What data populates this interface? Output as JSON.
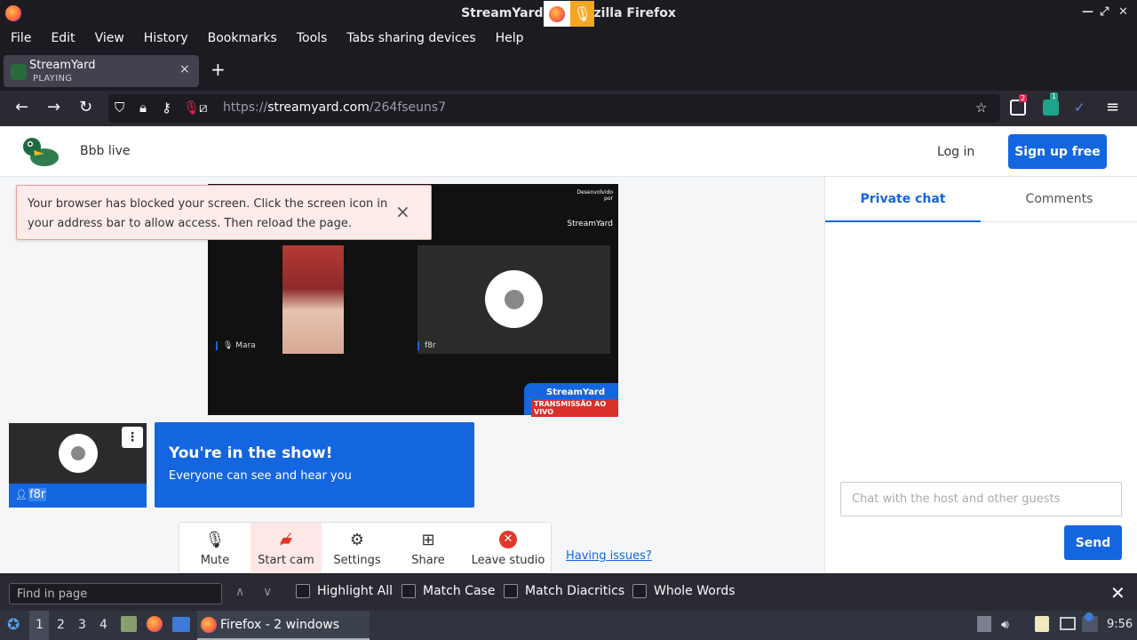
{
  "window": {
    "title": "StreamYard - Mozilla Firefox",
    "title_visible": "StreamYard",
    "title_suffix": "zilla Firefox"
  },
  "menubar": {
    "items": [
      "File",
      "Edit",
      "View",
      "History",
      "Bookmarks",
      "Tools",
      "Tabs sharing devices",
      "Help"
    ]
  },
  "tab": {
    "title": "StreamYard",
    "status": "PLAYING",
    "close": "×"
  },
  "newtab": "+",
  "urlbar": {
    "domain_prefix": "https://",
    "domain": "streamyard.com",
    "path": "/264fseuns7"
  },
  "extensions": {
    "badge1": "2",
    "badge2": "1"
  },
  "site": {
    "room_name": "Bbb live",
    "login": "Log in",
    "signup": "Sign up free"
  },
  "alert": {
    "message": "Your browser has blocked your screen. Click the screen icon in your address bar to allow access. Then reload the page.",
    "close": "×"
  },
  "stage": {
    "participant1": "Mara",
    "participant2": "f8r",
    "brand_small": "Desenvolvido por",
    "brand_name": "StreamYard",
    "banner_title": "StreamYard",
    "banner_live": "TRANSMISSÃO AO VIVO"
  },
  "self_tile": {
    "name": "f8r",
    "menu": "⋮"
  },
  "in_show": {
    "title": "You're in the show!",
    "subtitle": "Everyone can see and hear you"
  },
  "controls": {
    "mute": "Mute",
    "start_cam": "Start cam",
    "settings": "Settings",
    "share": "Share",
    "leave": "Leave studio"
  },
  "having_issues": "Having issues?",
  "chat": {
    "tab_private": "Private chat",
    "tab_comments": "Comments",
    "placeholder": "Chat with the host and other guests",
    "send": "Send"
  },
  "findbar": {
    "placeholder": "Find in page",
    "highlight_all": "Highlight All",
    "match_case": "Match Case",
    "match_diacritics": "Match Diacritics",
    "whole_words": "Whole Words"
  },
  "taskbar": {
    "workspaces": [
      "1",
      "2",
      "3",
      "4"
    ],
    "window_label": "Firefox - 2 windows",
    "clock": "9:56"
  },
  "colors": {
    "accent": "#1466e0",
    "alert_bg": "#fdecea",
    "stop_red": "#e0392b"
  }
}
